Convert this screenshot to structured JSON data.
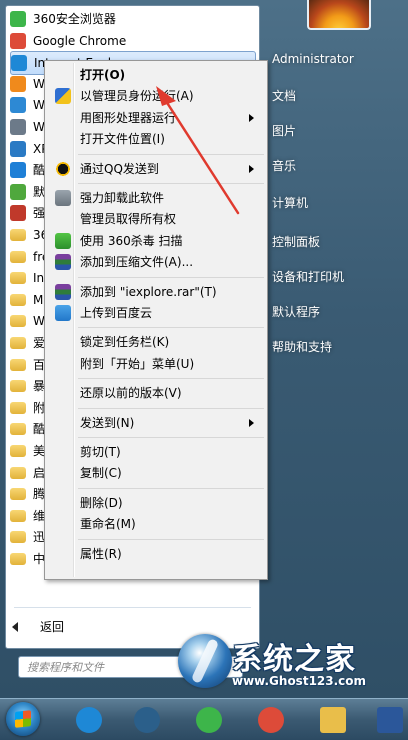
{
  "left_pane": {
    "programs": [
      {
        "label": "360安全浏览器",
        "icon": "browser-360-icon",
        "color": "#3db54a"
      },
      {
        "label": "Google Chrome",
        "icon": "chrome-icon",
        "color": "#dd4b39"
      },
      {
        "label": "Internet Explorer",
        "icon": "ie-icon",
        "color": "#1e88d6"
      },
      {
        "label": "W",
        "icon": "wmp-icon",
        "color": "#f08a1c"
      },
      {
        "label": "Wi",
        "icon": "windows-icon",
        "color": "#2d89d4"
      },
      {
        "label": "Wi",
        "icon": "fax-icon",
        "color": "#6c7a89"
      },
      {
        "label": "XP",
        "icon": "xps-icon",
        "color": "#2a7ac4"
      },
      {
        "label": "酷",
        "icon": "kugou-icon",
        "color": "#1e7fd6"
      },
      {
        "label": "默",
        "icon": "default-programs-icon",
        "color": "#4fa83d"
      },
      {
        "label": "强",
        "icon": "uninstall-icon",
        "color": "#c0392b"
      },
      {
        "label": "36",
        "icon": "folder-icon",
        "color": "#e9be4a"
      },
      {
        "label": "fre",
        "icon": "folder-icon",
        "color": "#e9be4a"
      },
      {
        "label": "Int",
        "icon": "folder-icon",
        "color": "#e9be4a"
      },
      {
        "label": "Mi",
        "icon": "folder-icon",
        "color": "#e9be4a"
      },
      {
        "label": "Wi",
        "icon": "folder-icon",
        "color": "#e9be4a"
      },
      {
        "label": "爱",
        "icon": "folder-icon",
        "color": "#e9be4a"
      },
      {
        "label": "百",
        "icon": "folder-icon",
        "color": "#e9be4a"
      },
      {
        "label": "暴",
        "icon": "folder-icon",
        "color": "#e9be4a"
      },
      {
        "label": "附",
        "icon": "folder-icon",
        "color": "#e9be4a"
      },
      {
        "label": "酷",
        "icon": "folder-icon",
        "color": "#e9be4a"
      },
      {
        "label": "美",
        "icon": "folder-icon",
        "color": "#e9be4a"
      },
      {
        "label": "启",
        "icon": "folder-icon",
        "color": "#e9be4a"
      },
      {
        "label": "腾",
        "icon": "folder-icon",
        "color": "#e9be4a"
      },
      {
        "label": "维",
        "icon": "folder-icon",
        "color": "#e9be4a"
      },
      {
        "label": "迅",
        "icon": "folder-icon",
        "color": "#e9be4a"
      },
      {
        "label": "中",
        "icon": "folder-icon",
        "color": "#e9be4a"
      }
    ],
    "back_label": "返回",
    "search_placeholder": "搜索程序和文件"
  },
  "right_pane": {
    "items": [
      "Administrator",
      "文档",
      "图片",
      "音乐",
      "计算机",
      "控制面板",
      "设备和打印机",
      "默认程序",
      "帮助和支持"
    ]
  },
  "context_menu": {
    "items": [
      {
        "label": "打开(O)",
        "bold": true,
        "icon": ""
      },
      {
        "label": "以管理员身份运行(A)",
        "icon": "uac-shield-icon"
      },
      {
        "label": "用图形处理器运行",
        "icon": "",
        "submenu": true
      },
      {
        "label": "打开文件位置(I)",
        "icon": ""
      },
      {
        "sep": true
      },
      {
        "label": "通过QQ发送到",
        "icon": "qq-icon",
        "submenu": true
      },
      {
        "sep": true
      },
      {
        "label": "强力卸载此软件",
        "icon": "trash-icon"
      },
      {
        "label": "管理员取得所有权",
        "icon": ""
      },
      {
        "label": "使用 360杀毒 扫描",
        "icon": "360-shield-icon"
      },
      {
        "label": "添加到压缩文件(A)...",
        "icon": "winrar-icon"
      },
      {
        "sep": true
      },
      {
        "label": "添加到 \"iexplore.rar\"(T)",
        "icon": "winrar-icon"
      },
      {
        "label": "上传到百度云",
        "icon": "baidu-cloud-icon"
      },
      {
        "sep": true
      },
      {
        "label": "锁定到任务栏(K)",
        "icon": ""
      },
      {
        "label": "附到「开始」菜单(U)",
        "icon": ""
      },
      {
        "sep": true
      },
      {
        "label": "还原以前的版本(V)",
        "icon": ""
      },
      {
        "sep": true
      },
      {
        "label": "发送到(N)",
        "icon": "",
        "submenu": true
      },
      {
        "sep": true
      },
      {
        "label": "剪切(T)",
        "icon": ""
      },
      {
        "label": "复制(C)",
        "icon": ""
      },
      {
        "sep": true
      },
      {
        "label": "删除(D)",
        "icon": ""
      },
      {
        "label": "重命名(M)",
        "icon": ""
      },
      {
        "sep": true
      },
      {
        "label": "属性(R)",
        "icon": ""
      }
    ]
  },
  "watermark": {
    "title": "系统之家",
    "url": "www.Ghost123.com"
  },
  "taskbar": {
    "items": [
      {
        "icon": "start-orb-icon"
      },
      {
        "icon": "ie-icon",
        "color": "#1e88d6"
      },
      {
        "icon": "media-player-icon",
        "color": "#2b5f8a"
      },
      {
        "icon": "browser-360-icon",
        "color": "#3db54a"
      },
      {
        "icon": "chrome-icon",
        "color": "#dd4b39"
      },
      {
        "icon": "explorer-folder-icon",
        "color": "#e9be4a"
      },
      {
        "icon": "word-icon",
        "color": "#2b579a"
      }
    ]
  }
}
